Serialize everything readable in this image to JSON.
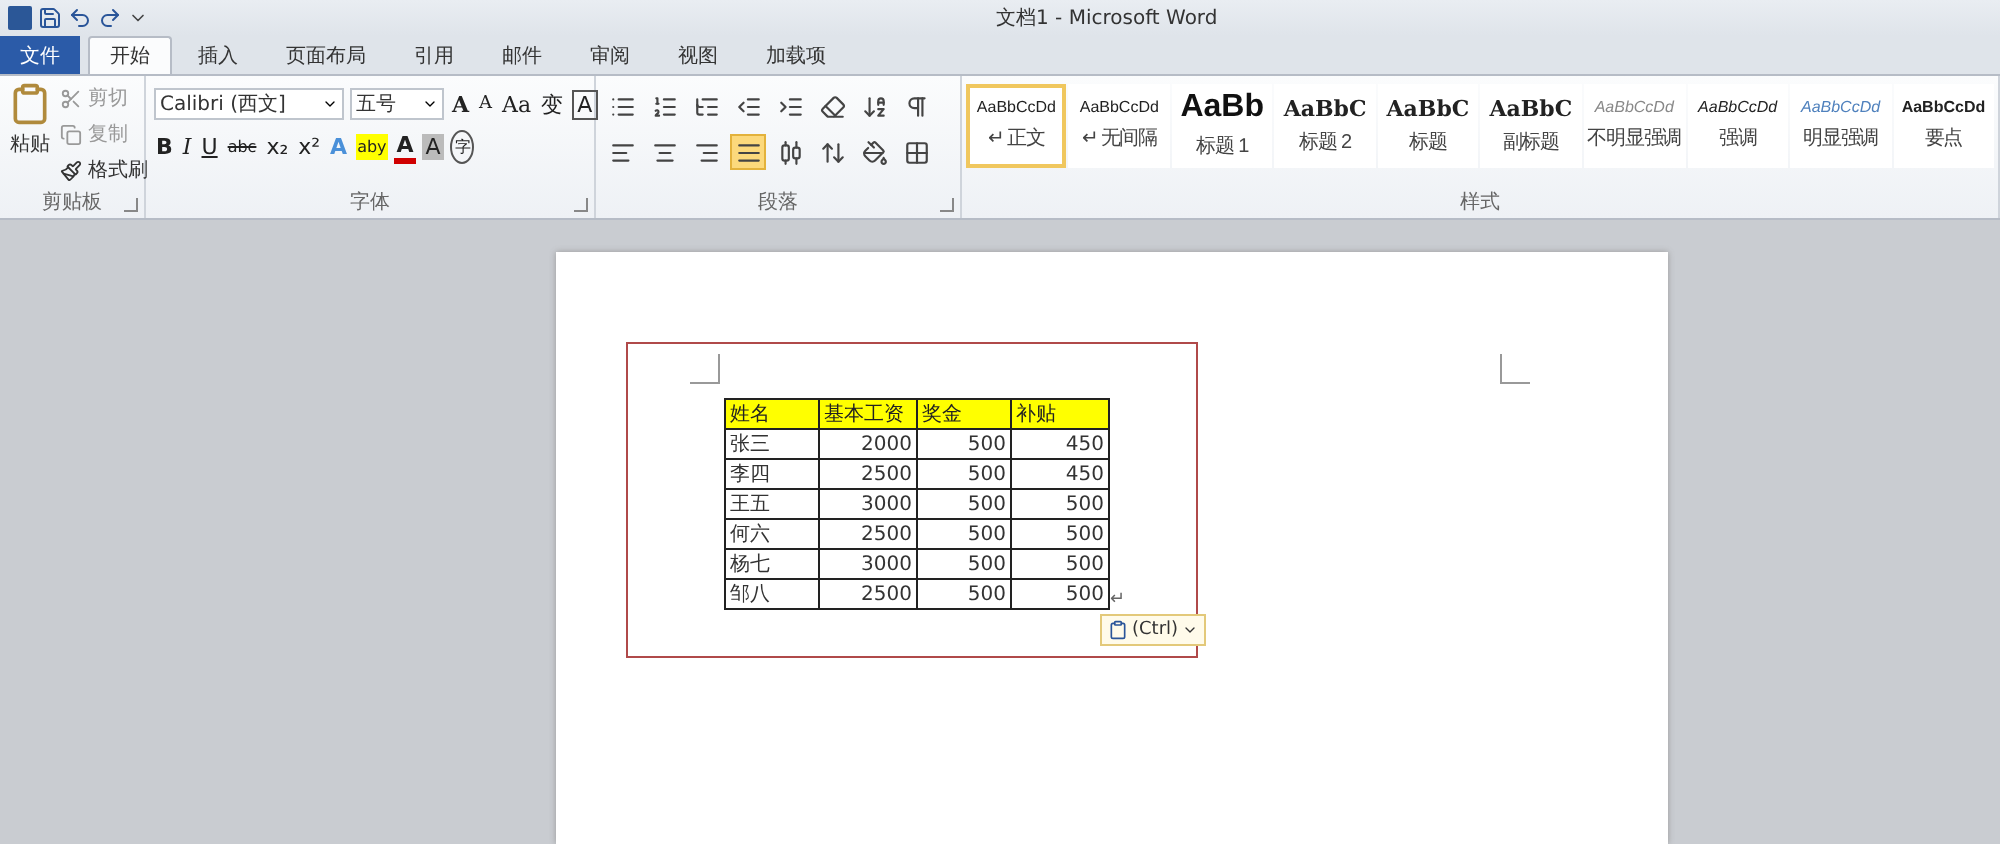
{
  "title_bar": {
    "title": "文档1 - Microsoft Word"
  },
  "tabs": [
    {
      "label": "文件",
      "kind": "file",
      "selected": false
    },
    {
      "label": "开始",
      "kind": "tab",
      "selected": true
    },
    {
      "label": "插入",
      "kind": "tab",
      "selected": false
    },
    {
      "label": "页面布局",
      "kind": "tab",
      "selected": false
    },
    {
      "label": "引用",
      "kind": "tab",
      "selected": false
    },
    {
      "label": "邮件",
      "kind": "tab",
      "selected": false
    },
    {
      "label": "审阅",
      "kind": "tab",
      "selected": false
    },
    {
      "label": "视图",
      "kind": "tab",
      "selected": false
    },
    {
      "label": "加载项",
      "kind": "tab",
      "selected": false
    }
  ],
  "clipboard": {
    "label": "剪贴板",
    "paste": "粘贴",
    "items": [
      {
        "label": "剪切",
        "disabled": true
      },
      {
        "label": "复制",
        "disabled": true
      },
      {
        "label": "格式刷",
        "disabled": false
      }
    ]
  },
  "font": {
    "label": "字体",
    "family": "Calibri (西文]",
    "size": "五号",
    "row1": [
      {
        "text": "A",
        "kind": "grow"
      },
      {
        "text": "A",
        "kind": "shrink"
      },
      {
        "text": "Aa",
        "kind": "dropdown"
      },
      {
        "text": "变",
        "kind": "plain"
      },
      {
        "text": "A",
        "kind": "boxed"
      }
    ],
    "row2": [
      {
        "text": "B",
        "kind": "bold"
      },
      {
        "text": "I",
        "kind": "italic"
      },
      {
        "text": "U",
        "kind": "underline"
      },
      {
        "text": "abc",
        "kind": "strike"
      },
      {
        "text": "x₂",
        "kind": "plain"
      },
      {
        "text": "x²",
        "kind": "plain"
      },
      {
        "text": "A",
        "kind": "effect"
      },
      {
        "text": "aby",
        "kind": "highlight"
      },
      {
        "text": "A",
        "kind": "color"
      },
      {
        "text": "A",
        "kind": "shaded"
      },
      {
        "text": "字",
        "kind": "circled"
      }
    ]
  },
  "paragraph": {
    "label": "段落",
    "alignments": [
      {
        "selected": false
      },
      {
        "selected": false
      },
      {
        "selected": false
      },
      {
        "selected": true
      },
      {
        "selected": false
      }
    ]
  },
  "styles": {
    "label": "样式",
    "items": [
      {
        "sample": "AaBbCcDd",
        "name": "↵ 正文",
        "kind": "normal",
        "selected": true
      },
      {
        "sample": "AaBbCcDd",
        "name": "↵ 无间隔",
        "kind": "normal",
        "selected": false
      },
      {
        "sample": "AaBb",
        "name": "标题 1",
        "kind": "h1",
        "selected": false
      },
      {
        "sample": "AaBbC",
        "name": "标题 2",
        "kind": "h2",
        "selected": false
      },
      {
        "sample": "AaBbC",
        "name": "标题",
        "kind": "h2",
        "selected": false
      },
      {
        "sample": "AaBbC",
        "name": "副标题",
        "kind": "h2",
        "selected": false
      },
      {
        "sample": "AaBbCcDd",
        "name": "不明显强调",
        "kind": "subtle",
        "selected": false
      },
      {
        "sample": "AaBbCcDd",
        "name": "强调",
        "kind": "emphasis",
        "selected": false
      },
      {
        "sample": "AaBbCcDd",
        "name": "明显强调",
        "kind": "intense",
        "selected": false
      },
      {
        "sample": "AaBbCcDd",
        "name": "要点",
        "kind": "strong",
        "selected": false
      }
    ]
  },
  "document": {
    "table": {
      "columns": [
        "姓名",
        "基本工资",
        "奖金",
        "补贴"
      ],
      "rows": [
        [
          "张三",
          "2000",
          "500",
          "450"
        ],
        [
          "李四",
          "2500",
          "500",
          "450"
        ],
        [
          "王五",
          "3000",
          "500",
          "500"
        ],
        [
          "何六",
          "2500",
          "500",
          "500"
        ],
        [
          "杨七",
          "3000",
          "500",
          "500"
        ],
        [
          "邹八",
          "2500",
          "500",
          "500"
        ]
      ],
      "end_mark": "↵"
    },
    "paste_options": "(Ctrl)"
  }
}
